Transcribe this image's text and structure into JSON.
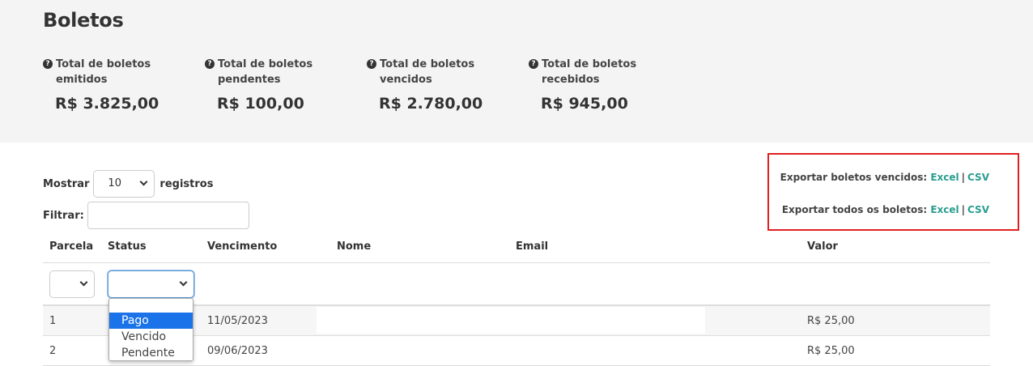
{
  "title": "Boletos",
  "stats": [
    {
      "label": "Total de boletos emitidos",
      "value": "R$ 3.825,00"
    },
    {
      "label": "Total de boletos pendentes",
      "value": "R$ 100,00"
    },
    {
      "label": "Total de boletos vencidos",
      "value": "R$ 2.780,00"
    },
    {
      "label": "Total de boletos recebidos",
      "value": "R$ 945,00"
    }
  ],
  "length_menu": {
    "prefix": "Mostrar",
    "value": "10",
    "suffix": "registros"
  },
  "filter": {
    "label": "Filtrar:",
    "value": ""
  },
  "export": {
    "overdue": {
      "label": "Exportar boletos vencidos:",
      "excel": "Excel",
      "sep": "|",
      "csv": "CSV"
    },
    "all": {
      "label": "Exportar todos os boletos:",
      "excel": "Excel",
      "sep": "|",
      "csv": "CSV"
    }
  },
  "table": {
    "columns": [
      "Parcela",
      "Status",
      "Vencimento",
      "Nome",
      "Email",
      "Valor"
    ],
    "rows": [
      {
        "parcela": "1",
        "vencimento": "11/05/2023",
        "valor": "R$ 25,00"
      },
      {
        "parcela": "2",
        "vencimento": "09/06/2023",
        "valor": "R$ 25,00"
      }
    ]
  },
  "status_dropdown": {
    "options": [
      "Pago",
      "Vencido",
      "Pendente"
    ],
    "highlighted": "Pago"
  },
  "colors": {
    "accent_link": "#2a9d8f",
    "highlight_box": "#e02020",
    "option_selected": "#1a73e8"
  }
}
